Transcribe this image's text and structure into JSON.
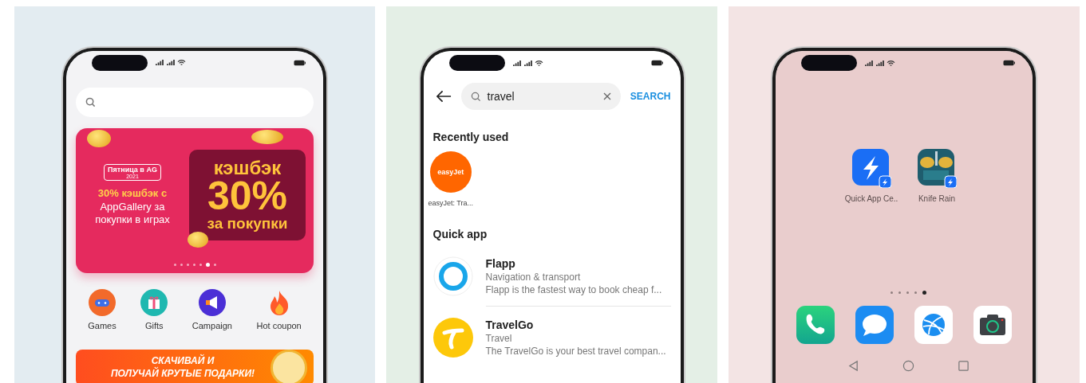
{
  "store_screen": {
    "banner": {
      "badge_title": "Пятница в AG",
      "badge_year": "2021",
      "headline": "30% кэшбэк с",
      "subline": "AppGallery за покупки в играх",
      "cashback_label": "кэшбэк",
      "cashback_value": "30%",
      "cashback_caption": "за покупки",
      "dots": [
        {
          "selected": false
        },
        {
          "selected": false
        },
        {
          "selected": false
        },
        {
          "selected": false
        },
        {
          "selected": false
        },
        {
          "selected": true
        },
        {
          "selected": false
        }
      ]
    },
    "categories": [
      {
        "label": "Games"
      },
      {
        "label": "Gifts"
      },
      {
        "label": "Campaign"
      },
      {
        "label": "Hot coupon"
      }
    ],
    "promo_banner": {
      "lines": [
        "СКАЧИВАЙ И",
        "ПОЛУЧАЙ КРУТЫЕ ПОДАРКИ!"
      ]
    }
  },
  "search_screen": {
    "search_field": {
      "value": "travel"
    },
    "search_button": "SEARCH",
    "recently_used": {
      "title": "Recently used",
      "apps": [
        {
          "logo": "easyJet",
          "label": "easyJet: Tra..."
        }
      ]
    },
    "quick_app": {
      "title": "Quick app",
      "items": [
        {
          "name": "Flapp",
          "category": "Navigation & transport",
          "description": "Flapp is the fastest way to book cheap f..."
        },
        {
          "name": "TravelGo",
          "category": "Travel",
          "description": "The TravelGo is your best travel compan..."
        }
      ]
    }
  },
  "home_screen": {
    "apps": [
      {
        "label": "Quick App Ce.."
      },
      {
        "label": "Knife Rain"
      }
    ],
    "page_dots": [
      {
        "selected": false
      },
      {
        "selected": false
      },
      {
        "selected": false
      },
      {
        "selected": false
      },
      {
        "selected": true
      }
    ]
  }
}
